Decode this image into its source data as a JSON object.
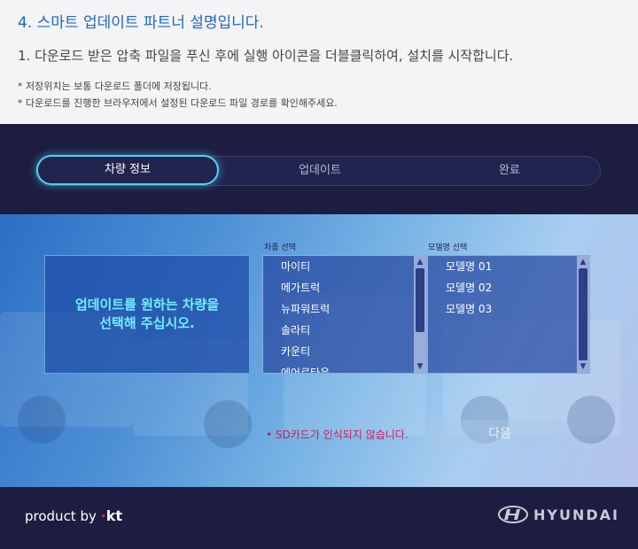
{
  "instructions": {
    "title": "4. 스마트 업데이트 파트너 설명입니다.",
    "description": "1. 다운로드 받은 압축 파일을 푸신 후에 실행 아이콘을 더블클릭하여, 설치를 시작합니다.",
    "notes": [
      "* 저장위치는 보통 다운로드 폴더에 저장됩니다.",
      "* 다운로드를 진행한 브라우저에서 설정된 다운로드 파일 경로를 확인해주세요."
    ]
  },
  "steps": [
    "차량 정보",
    "업데이트",
    "완료"
  ],
  "prompt": {
    "line1": "업데이트를 원하는 차량을",
    "line2": "선택해 주십시오."
  },
  "vehicle_type": {
    "label": "차종 선택",
    "items": [
      "마이티",
      "메가트럭",
      "뉴파워트럭",
      "솔라티",
      "카운티",
      "에어로타운"
    ]
  },
  "model": {
    "label": "모델명 선택",
    "items": [
      "모델명 01",
      "모델명 02",
      "모델명 03"
    ]
  },
  "error_text": "• SD카드가 인식되지 않습니다.",
  "next_label": "다음",
  "footer": {
    "product_by": "product by",
    "kt_logo": "kt",
    "brand": "HYUNDAI"
  },
  "colors": {
    "accent": "#4fd0f5",
    "title_blue": "#1e67c2",
    "error": "#c81e5a",
    "app_bg": "#1c1d40"
  }
}
